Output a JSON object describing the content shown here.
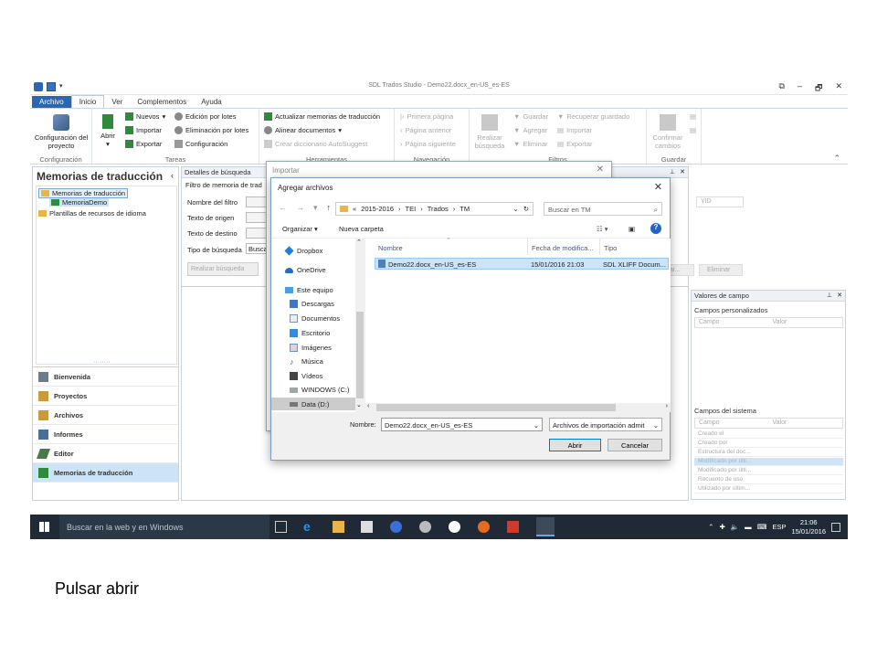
{
  "app": {
    "title": "SDL Trados Studio - Demo22.docx_en-US_es-ES"
  },
  "tabs": [
    "Archivo",
    "Inicio",
    "Ver",
    "Complementos",
    "Ayuda"
  ],
  "ribbon": {
    "config": {
      "big": "Configuración del proyecto",
      "group": "Configuración"
    },
    "tareas": {
      "abrir": "Abrir",
      "nuevos": "Nuevos",
      "importar": "Importar",
      "exportar": "Exportar",
      "edicion": "Edición por lotes",
      "eliminacion": "Eliminación por lotes",
      "configuracion": "Configuración",
      "group": "Tareas"
    },
    "herramientas": {
      "actualizar": "Actualizar memorias de traducción",
      "alinear": "Alinear documentos",
      "crear": "Crear diccionario AutoSuggest",
      "group": "Herramientas"
    },
    "navegacion": {
      "primera": "Primera página",
      "anterior": "Página anterior",
      "siguiente": "Página siguiente",
      "group": "Navegación"
    },
    "filtros": {
      "realizar": "Realizar búsqueda",
      "guardar": "Guardar",
      "agregar": "Agregar",
      "eliminar": "Eliminar",
      "recuperar": "Recuperar guardado",
      "importar": "Importar",
      "exportar": "Exportar",
      "group": "Filtros"
    },
    "guardar": {
      "confirmar": "Confirmar cambios",
      "group": "Guardar"
    }
  },
  "left_panel": {
    "title": "Memorias de traducción",
    "tree": [
      "Memorias de traducción",
      "MemoriaDemo",
      "Plantillas de recursos de idioma"
    ],
    "nav": [
      "Bienvenida",
      "Proyectos",
      "Archivos",
      "Informes",
      "Editor",
      "Memorias de traducción"
    ]
  },
  "center_panel": {
    "title": "Detalles de búsqueda",
    "filter": "Filtro de memoria de trad",
    "fields": [
      "Nombre del filtro",
      "Texto de origen",
      "Texto de destino",
      "Tipo de búsqueda"
    ],
    "tipo_value": "Busca",
    "search_btn": "Realizar búsqueda",
    "yid": "YID",
    "ar": "ar...",
    "eliminar": "Eliminar"
  },
  "right_panel": {
    "title": "Valores de campo",
    "custom": "Campos personalizados",
    "campo": "Campo",
    "valor": "Valor",
    "system": "Campos del sistema",
    "rows": [
      "Creado el",
      "Creado por",
      "Estructura del doc...",
      "Modificado por últi...",
      "Modificado por últi...",
      "Recuento de uso",
      "Utilizado por últim..."
    ]
  },
  "import_window": {
    "title": "Importar"
  },
  "dialog": {
    "title": "Agregar archivos",
    "path": [
      "«",
      "2015-2016",
      "TEI",
      "Trados",
      "TM"
    ],
    "search_placeholder": "Buscar en TM",
    "organizar": "Organizar ▾",
    "nueva_carpeta": "Nueva carpeta",
    "nav": [
      "Dropbox",
      "OneDrive",
      "Este equipo",
      "Descargas",
      "Documentos",
      "Escritorio",
      "Imágenes",
      "Música",
      "Vídeos",
      "WINDOWS (C:)",
      "Data (D:)"
    ],
    "columns": [
      "Nombre",
      "Fecha de modifica...",
      "Tipo"
    ],
    "file": {
      "name": "Demo22.docx_en-US_es-ES",
      "date": "15/01/2016 21:03",
      "type": "SDL XLIFF Docum..."
    },
    "nombre_label": "Nombre:",
    "nombre_value": "Demo22.docx_en-US_es-ES",
    "filter": "Archivos de importación admit",
    "abrir": "Abrir",
    "cancelar": "Cancelar"
  },
  "taskbar": {
    "search": "Buscar en la web y en Windows",
    "lang": "ESP",
    "time": "21:06",
    "date": "15/01/2016"
  },
  "caption": "Pulsar abrir"
}
